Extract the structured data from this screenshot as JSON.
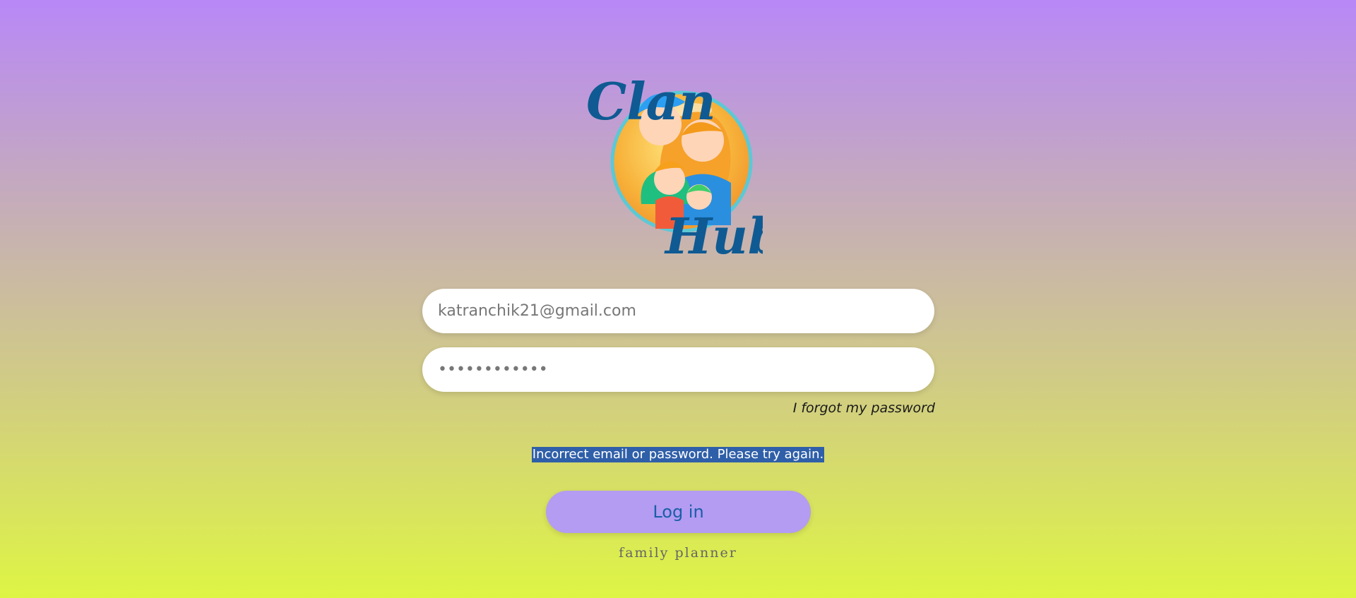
{
  "logo": {
    "text_top": "Clan",
    "text_bottom": "Hub",
    "colors": {
      "wordmark": "#0f5a93",
      "circle": "#f6b73c",
      "ring": "#5cc8d6"
    }
  },
  "form": {
    "email_value": "katranchik21@gmail.com",
    "password_value": "••••••••••••",
    "forgot_label": "I forgot my password",
    "error_message": "Incorrect email or password. Please try again.",
    "login_label": "Log in"
  },
  "tagline": "family planner",
  "colors": {
    "gradient_top": "#b888f7",
    "gradient_bottom": "#def544",
    "button_bg": "#b39cf1",
    "button_text": "#1a5ea8",
    "error_bg": "#2f5fa8"
  }
}
